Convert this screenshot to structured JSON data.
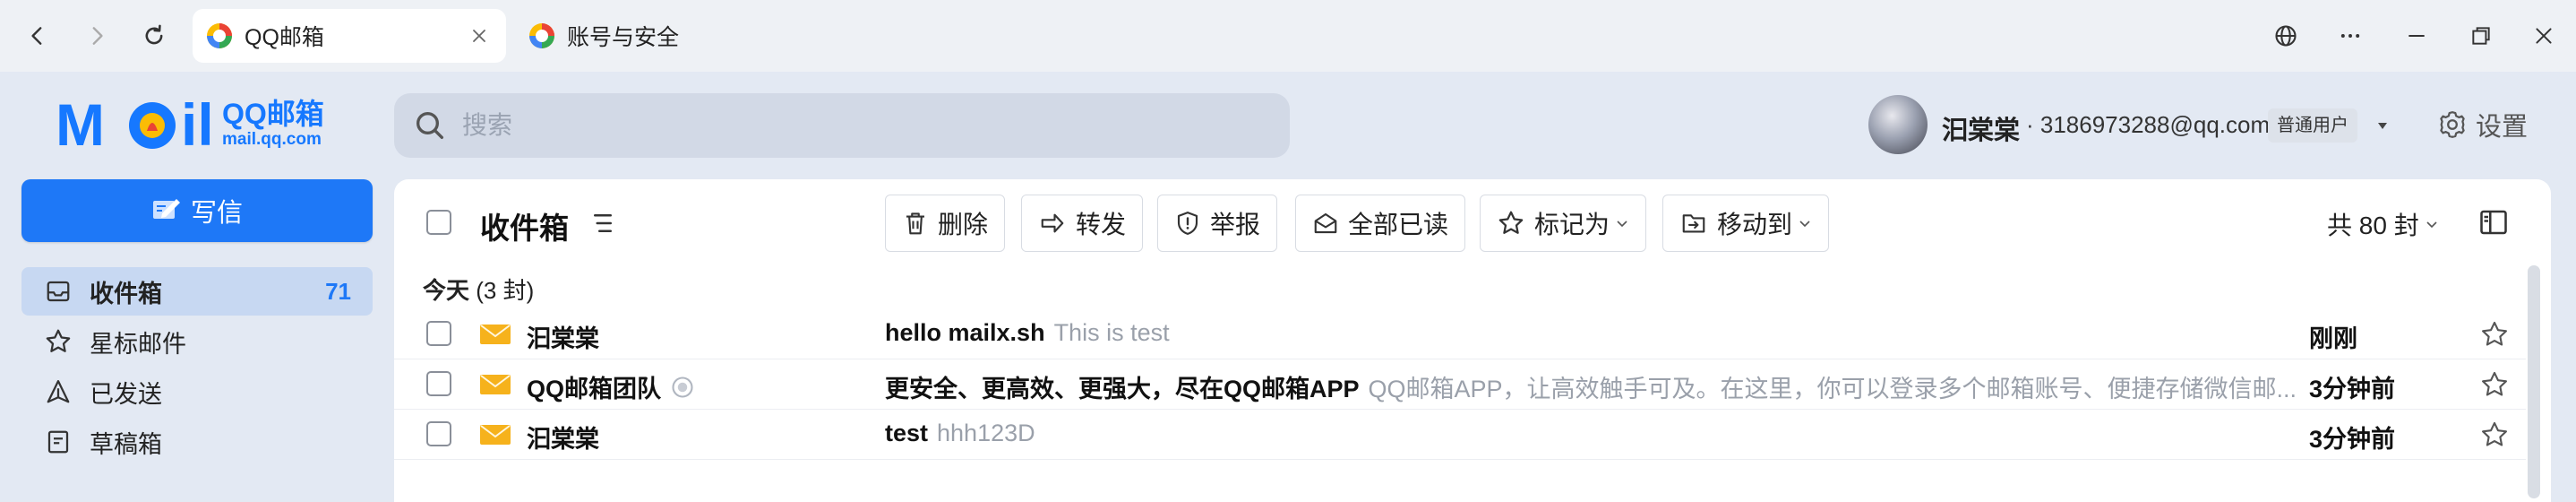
{
  "browser": {
    "tabs": [
      {
        "label": "QQ邮箱",
        "active": true
      },
      {
        "label": "账号与安全",
        "active": false
      }
    ]
  },
  "header": {
    "logo_qq": "QQ邮箱",
    "logo_url": "mail.qq.com",
    "search_placeholder": "搜索",
    "user_name": "汩棠棠",
    "user_email": "· 3186973288@qq.com",
    "user_badge": "普通用户",
    "settings_label": "设置"
  },
  "sidebar": {
    "compose_label": "写信",
    "items": [
      {
        "label": "收件箱",
        "count": "71",
        "icon": "inbox-icon",
        "active": true
      },
      {
        "label": "星标邮件",
        "count": "",
        "icon": "star-icon",
        "active": false
      },
      {
        "label": "已发送",
        "count": "",
        "icon": "send-icon",
        "active": false
      },
      {
        "label": "草稿箱",
        "count": "",
        "icon": "draft-icon",
        "active": false
      }
    ]
  },
  "main": {
    "folder_title": "收件箱",
    "toolbar": {
      "delete": "删除",
      "forward": "转发",
      "report": "举报",
      "mark_all_read": "全部已读",
      "mark_as": "标记为",
      "move_to": "移动到"
    },
    "total": "共 80 封",
    "group": {
      "label": "今天",
      "count": "(3 封)"
    },
    "emails": [
      {
        "sender": "汩棠棠",
        "subject": "hello mailx.sh",
        "preview": "This is test",
        "time": "刚刚",
        "official": false
      },
      {
        "sender": "QQ邮箱团队",
        "subject": "更安全、更高效、更强大，尽在QQ邮箱APP",
        "preview": "QQ邮箱APP，让高效触手可及。在这里，你可以登录多个邮箱账号、便捷存储微信邮...",
        "time": "3分钟前",
        "official": true
      },
      {
        "sender": "汩棠棠",
        "subject": "test",
        "preview": "hhh123D",
        "time": "3分钟前",
        "official": false
      }
    ]
  },
  "colors": {
    "accent": "#1e78f7",
    "page_bg": "#e3e9f3",
    "sidebar_active": "#c7d8f2",
    "envelope": "#f6b21c"
  }
}
